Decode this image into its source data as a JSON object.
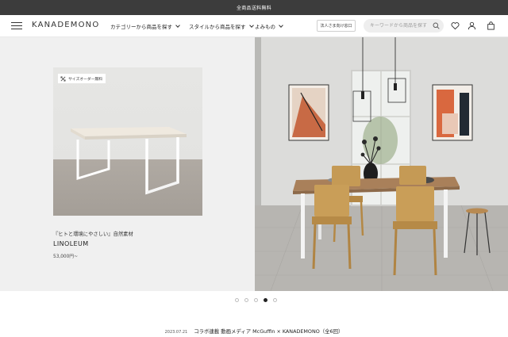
{
  "announcement": {
    "text": "全商品送料無料"
  },
  "header": {
    "logo": "KANADEMONO",
    "nav": [
      {
        "label": "カテゴリーから商品を探す"
      },
      {
        "label": "スタイルから商品を探す"
      },
      {
        "label": "よみもの"
      }
    ],
    "corporate_button": "法人さま向け窓口",
    "search": {
      "placeholder": "キーワードから商品を探す",
      "value": ""
    },
    "icons": [
      "search-icon",
      "heart-icon",
      "user-icon",
      "bag-icon"
    ]
  },
  "hero": {
    "card": {
      "badge": "サイズオーダー無料",
      "caption": "『ヒトと環境にやさしい』自然素材",
      "name": "LINOLEUM",
      "price": "53,000円~"
    },
    "pagination": {
      "count": 5,
      "active_index": 3
    }
  },
  "news": {
    "date": "2023.07.21",
    "text": "コラボ連載 動画メディア McGuffin × KANADEMONO（全6回）"
  },
  "colors": {
    "announcement_bg": "#3c3c3c",
    "hero_left_bg": "#f0f0f0",
    "table_top": "#efe9df",
    "table_legs": "#ffffff",
    "room_wall": "#dcdcda"
  }
}
